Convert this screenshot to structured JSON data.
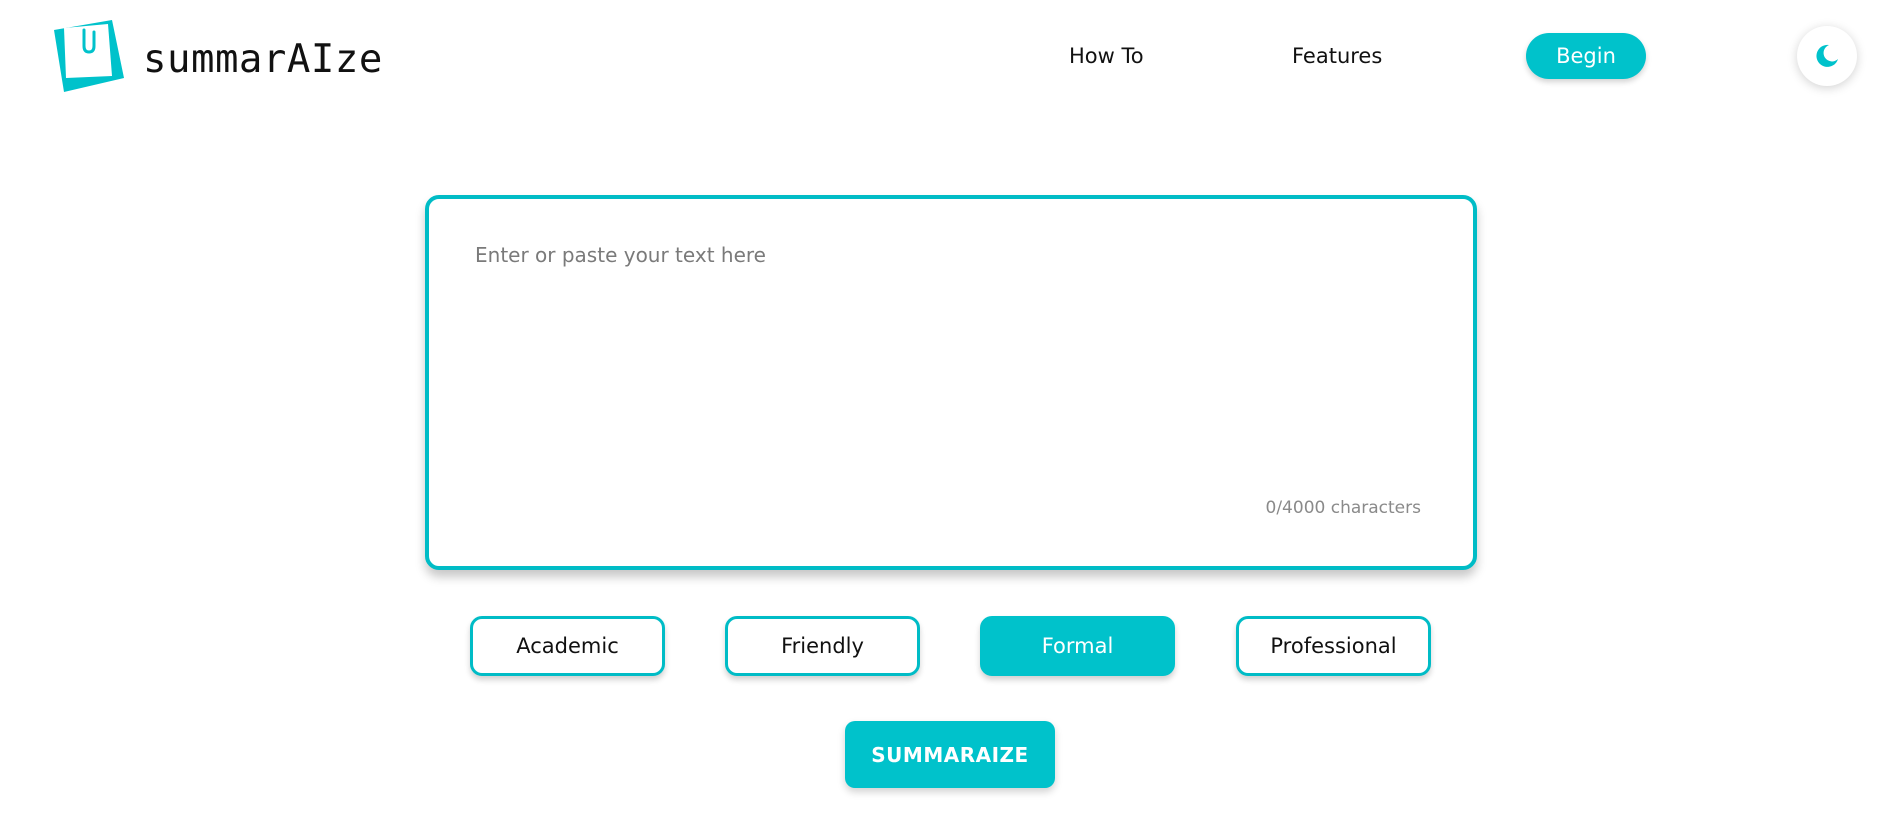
{
  "header": {
    "brand": "summarAIze",
    "logo_icon": "sticky-note-paperclip-icon",
    "nav": {
      "how_to": "How To",
      "features": "Features",
      "begin": "Begin"
    },
    "theme_toggle_icon": "moon-icon"
  },
  "editor": {
    "placeholder": "Enter or paste your text here",
    "value": "",
    "char_count": "0/4000 characters"
  },
  "tones": [
    {
      "label": "Academic",
      "selected": false
    },
    {
      "label": "Friendly",
      "selected": false
    },
    {
      "label": "Formal",
      "selected": true
    },
    {
      "label": "Professional",
      "selected": false
    }
  ],
  "actions": {
    "summarize": "SUMMARAIZE"
  },
  "colors": {
    "accent": "#00c2cb",
    "border": "#00bcc6",
    "background": "#ffffff"
  }
}
